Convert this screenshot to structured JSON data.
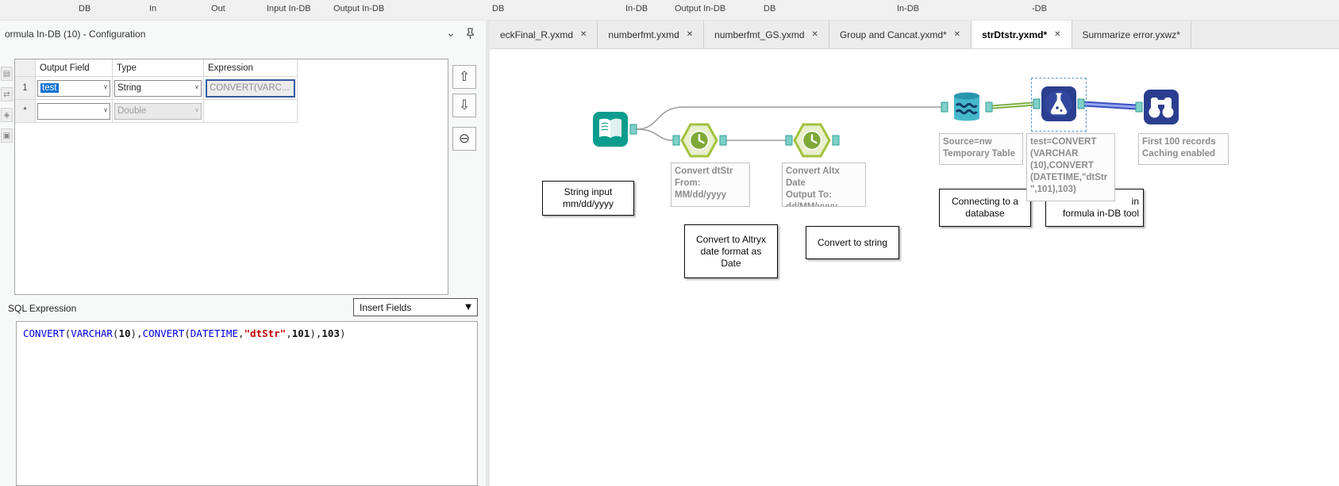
{
  "icons": {
    "close": "✕",
    "chevron_down": "⌄",
    "dropdown_arrow": "▼",
    "combo_arrow": "∨",
    "move_up": "⇧",
    "move_down": "⇩",
    "delete_row": "⊖",
    "side_1": "▤",
    "side_2": "⇄",
    "side_3": "◈",
    "side_4": "▣"
  },
  "top_toolbar": {
    "labels": [
      "DB",
      "In",
      "Out",
      "Input In-DB",
      "Output In-DB",
      "DB",
      "In-DB",
      "Output In-DB",
      "DB",
      "In-DB",
      "-DB"
    ]
  },
  "config_panel": {
    "title": "ormula In-DB (10) - Configuration",
    "grid": {
      "headers": [
        "Output Field",
        "Type",
        "Expression"
      ],
      "rows": [
        {
          "num": "1",
          "field": "test",
          "type": "String",
          "expression": "CONVERT(VARC..."
        },
        {
          "num": "*",
          "field": "",
          "type": "Double",
          "expression": ""
        }
      ]
    },
    "sql_label": "SQL Expression",
    "insert_fields": "Insert Fields",
    "sql_tokens": [
      {
        "text": "CONVERT",
        "type": "kw"
      },
      {
        "text": "(",
        "type": "p"
      },
      {
        "text": "VARCHAR",
        "type": "kw"
      },
      {
        "text": "(",
        "type": "p"
      },
      {
        "text": "10",
        "type": "num"
      },
      {
        "text": ")",
        "type": "p"
      },
      {
        "text": ",",
        "type": "p"
      },
      {
        "text": "CONVERT",
        "type": "kw"
      },
      {
        "text": "(",
        "type": "p"
      },
      {
        "text": "DATETIME",
        "type": "kw"
      },
      {
        "text": ",",
        "type": "p"
      },
      {
        "text": "\"dtStr\"",
        "type": "str"
      },
      {
        "text": ",",
        "type": "p"
      },
      {
        "text": "101",
        "type": "num"
      },
      {
        "text": ")",
        "type": "p"
      },
      {
        "text": ",",
        "type": "p"
      },
      {
        "text": "103",
        "type": "num"
      },
      {
        "text": ")",
        "type": "p"
      }
    ]
  },
  "tabs": [
    {
      "label": "eckFinal_R.yxmd"
    },
    {
      "label": "numberfmt.yxmd"
    },
    {
      "label": "numberfmt_GS.yxmd"
    },
    {
      "label": "Group and Cancat.yxmd*"
    },
    {
      "label": "strDtstr.yxmd*"
    },
    {
      "label": "Summarize error.yxwz*"
    }
  ],
  "canvas": {
    "annotations": {
      "datetime1": "Convert dtStr\nFrom:\nMM/dd/yyyy",
      "datetime2": "Convert Altx Date\nOutput To:\ndd/MM/yyyy",
      "stream_in": "Source=nw\nTemporary Table",
      "formula": "test=CONVERT\n(VARCHAR\n(10),CONVERT\n(DATETIME,\"dtStr\n\",101),103)",
      "browse": "First 100 records\nCaching enabled"
    },
    "comments": {
      "string_input": "String input\nmm/dd/yyyy",
      "convert_altryx": "Convert to Altryx\ndate format as\nDate",
      "convert_string": "Convert to string",
      "connecting_db": "Connecting to a\ndatabase",
      "formula_indb": "in\nformula in-DB tool"
    }
  }
}
